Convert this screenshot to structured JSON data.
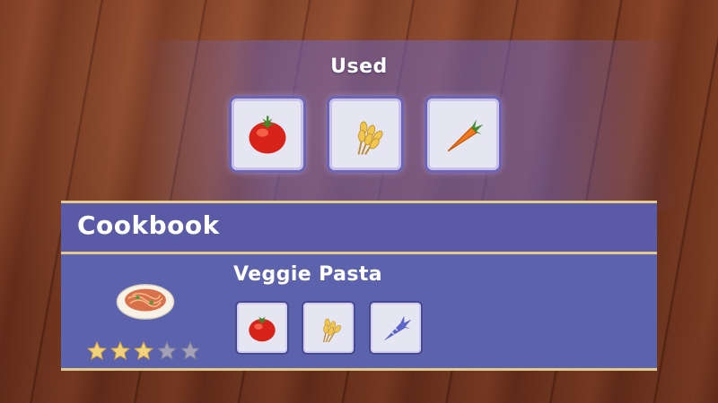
{
  "used": {
    "title": "Used",
    "items": [
      {
        "name": "Tomato",
        "icon": "tomato-icon"
      },
      {
        "name": "Wheat",
        "icon": "wheat-icon"
      },
      {
        "name": "Carrot",
        "icon": "carrot-icon"
      }
    ]
  },
  "cookbook": {
    "title": "Cookbook",
    "recipe": {
      "name": "Veggie Pasta",
      "icon": "veggie-pasta-icon",
      "rating": 3,
      "max_rating": 5,
      "ingredients": [
        {
          "name": "Tomato",
          "icon": "tomato-icon",
          "known": true
        },
        {
          "name": "Wheat",
          "icon": "wheat-icon",
          "known": true
        },
        {
          "name": "Carrot",
          "icon": "carrot-icon",
          "known": false
        }
      ]
    }
  },
  "colors": {
    "panel": "#5b5fa8",
    "trim": "#e2c98c",
    "star_on": "#f2d27a",
    "star_off": "#a3a0b8",
    "slot_bg": "#e6e6f2"
  }
}
